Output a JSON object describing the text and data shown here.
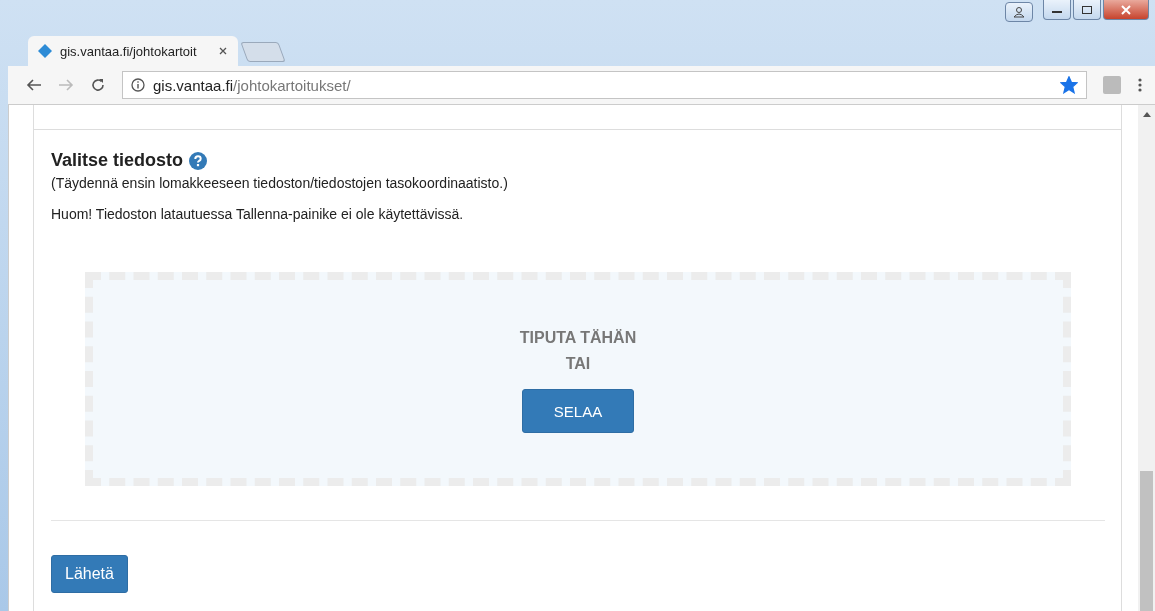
{
  "browser": {
    "tab": {
      "title": "gis.vantaa.fi/johtokartoit",
      "selected": true
    },
    "address": {
      "host": "gis.vantaa.fi",
      "path": "/johtokartoitukset/"
    },
    "bookmarked": true
  },
  "section": {
    "title": "Valitse tiedosto",
    "note": "(Täydennä ensin lomakkeeseen tiedoston/tiedostojen tasokoordinaatisto.)",
    "warning": "Huom! Tiedoston latautuessa Tallenna-painike ei ole käytettävissä."
  },
  "dropzone": {
    "lines": [
      "TIPUTA TÄHÄN",
      "TAI"
    ],
    "button": "SELAA"
  },
  "submit": "Lähetä"
}
